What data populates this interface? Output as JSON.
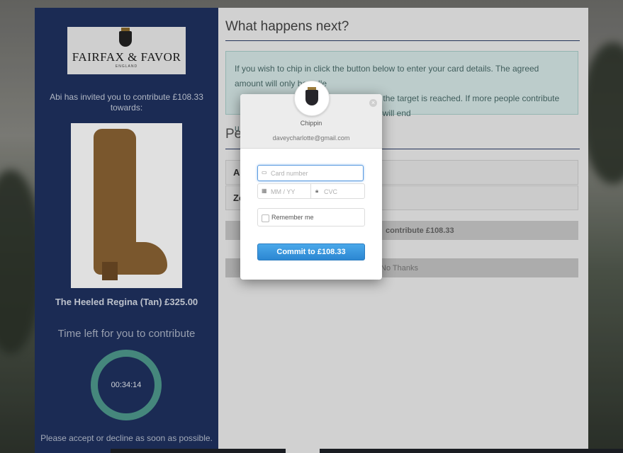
{
  "sidebar": {
    "logo": {
      "brand": "FAIRFAX & FAVOR",
      "sub": "ENGLAND"
    },
    "invite_text": "Abi has invited you to contribute £108.33 towards:",
    "product_name": "The Heeled Regina (Tan) £325.00",
    "time_left_label": "Time left for you to contribute",
    "timer": "00:34:14",
    "note": "Please accept or decline as soon as possible."
  },
  "main": {
    "title": "What happens next?",
    "info": "If you wish to chip in click the button below to enter your card details. The agreed amount will only be colle",
    "info_line2": "hen the target is reached. If more people contribute you will end",
    "info_line3": "u",
    "section_heading": "Pe",
    "rows": [
      {
        "label": "Al"
      },
      {
        "label": "Zo"
      }
    ],
    "contribute_button": "contribute £108.33",
    "decline_button": "No Thanks"
  },
  "modal": {
    "name": "Chippin",
    "email": "daveycharlotte@gmail.com",
    "close_glyph": "×",
    "card_placeholder": "Card number",
    "expiry_placeholder": "MM / YY",
    "cvc_placeholder": "CVC",
    "remember_label": "Remember me",
    "commit_label": "Commit to £108.33"
  },
  "colors": {
    "sidebar": "#1f3260",
    "accent": "#2c87d2",
    "timer_ring": "#4f9a8e"
  }
}
